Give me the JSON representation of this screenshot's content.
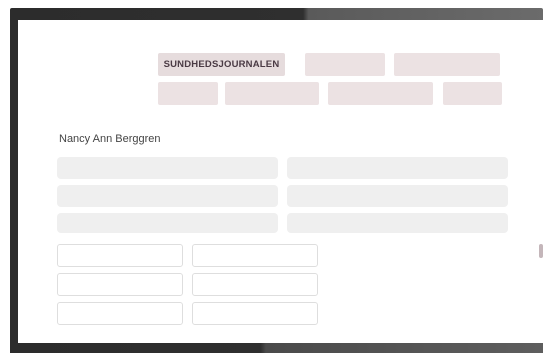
{
  "tabs": [
    {
      "label": "SUNDHEDSJOURNALEN",
      "active": true
    },
    {
      "label": "",
      "active": false
    },
    {
      "label": "",
      "active": false
    },
    {
      "label": "",
      "active": false
    },
    {
      "label": "",
      "active": false
    },
    {
      "label": "",
      "active": false
    },
    {
      "label": "",
      "active": false
    }
  ],
  "patient": {
    "name": "Nancy Ann Berggren"
  },
  "colors": {
    "tab_fill": "#ece2e3",
    "field_fill": "#efefef",
    "bezel": "#2c2c2c"
  }
}
